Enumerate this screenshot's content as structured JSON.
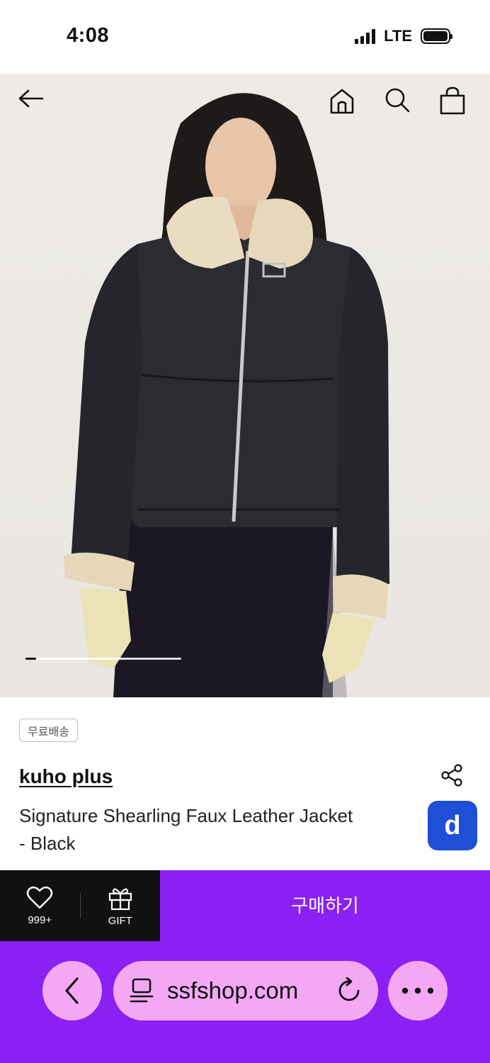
{
  "status_bar": {
    "time": "4:08",
    "network": "LTE"
  },
  "hero": {
    "image_alt": "model-wearing-shearling-leather-jacket",
    "carousel_position": 1,
    "carousel_fraction": 0.07
  },
  "nav": {
    "back_icon": "back-arrow-icon",
    "home_icon": "home-icon",
    "search_icon": "search-icon",
    "bag_icon": "shopping-bag-icon"
  },
  "product": {
    "badge": "무료배송",
    "brand": "kuho plus",
    "name_line1": "Signature Shearling Faux Leather Jacket",
    "name_line2": "- Black",
    "d_button_label": "d"
  },
  "action_bar": {
    "wishlist_count": "999+",
    "gift_label": "GIFT",
    "buy_label": "구매하기"
  },
  "browser": {
    "url": "ssfshop.com"
  },
  "colors": {
    "accent_purple": "#8b20f5",
    "pill_pink": "#f4a8f4",
    "d_blue": "#1f4fd6",
    "action_black": "#111111"
  }
}
